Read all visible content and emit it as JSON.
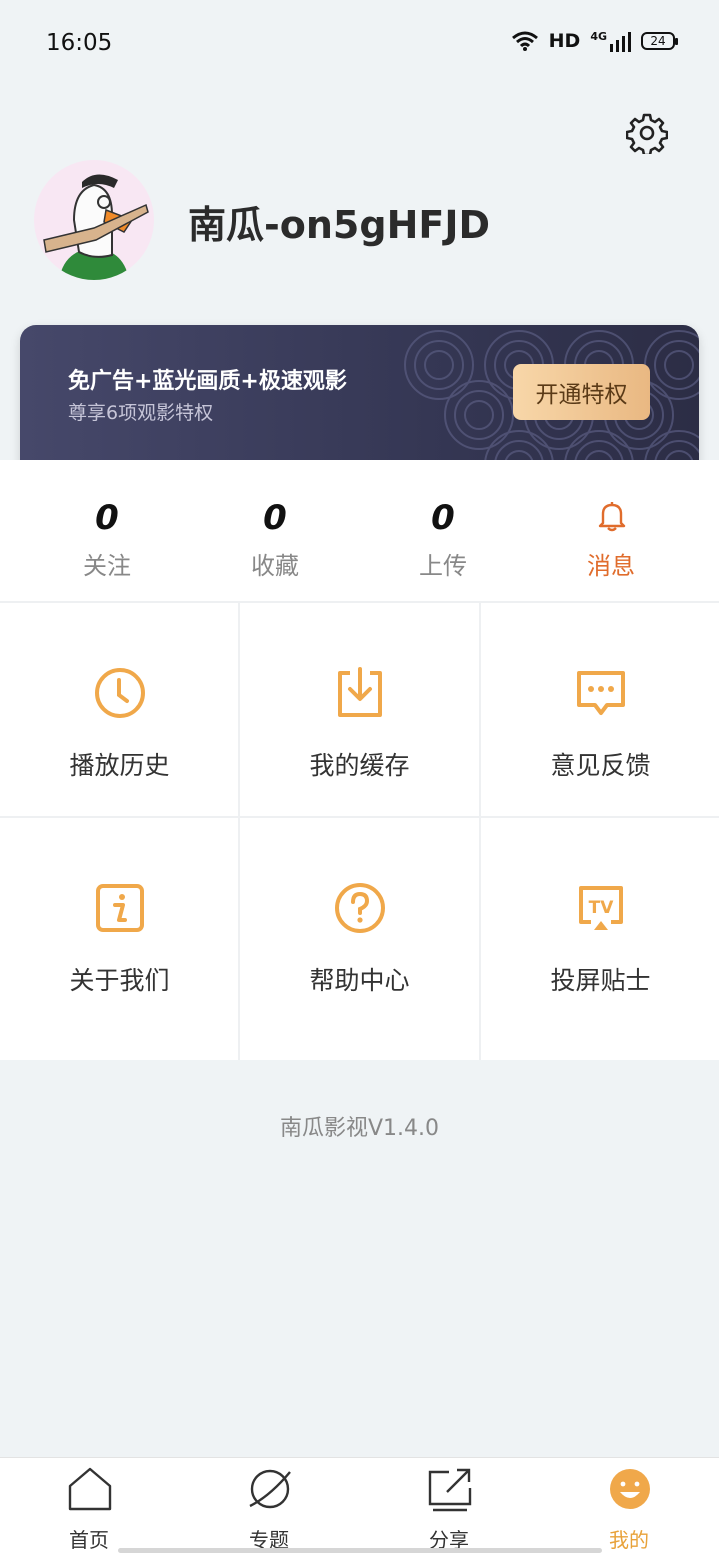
{
  "status_bar": {
    "time": "16:05",
    "network": "HD",
    "signal": "4G",
    "battery": "24"
  },
  "profile": {
    "username": "南瓜-on5gHFJD"
  },
  "vip": {
    "title": "免广告+蓝光画质+极速观影",
    "subtitle": "尊享6项观影特权",
    "button": "开通特权"
  },
  "stats": [
    {
      "value": "0",
      "label": "关注"
    },
    {
      "value": "0",
      "label": "收藏"
    },
    {
      "value": "0",
      "label": "上传"
    },
    {
      "label": "消息",
      "icon": "bell-icon"
    }
  ],
  "grid": [
    {
      "label": "播放历史",
      "icon": "clock-icon"
    },
    {
      "label": "我的缓存",
      "icon": "download-icon"
    },
    {
      "label": "意见反馈",
      "icon": "chat-icon"
    },
    {
      "label": "关于我们",
      "icon": "info-icon"
    },
    {
      "label": "帮助中心",
      "icon": "help-icon"
    },
    {
      "label": "投屏贴士",
      "icon": "tv-cast-icon"
    }
  ],
  "version": "南瓜影视V1.4.0",
  "nav": [
    {
      "label": "首页",
      "icon": "home-icon"
    },
    {
      "label": "专题",
      "icon": "planet-icon"
    },
    {
      "label": "分享",
      "icon": "share-icon"
    },
    {
      "label": "我的",
      "icon": "smile-icon",
      "active": true
    }
  ],
  "colors": {
    "accent": "#f0a84a",
    "active_label": "#e06c2c",
    "vip_bg": "#3a3c5c",
    "vip_button": "#f3c995"
  }
}
